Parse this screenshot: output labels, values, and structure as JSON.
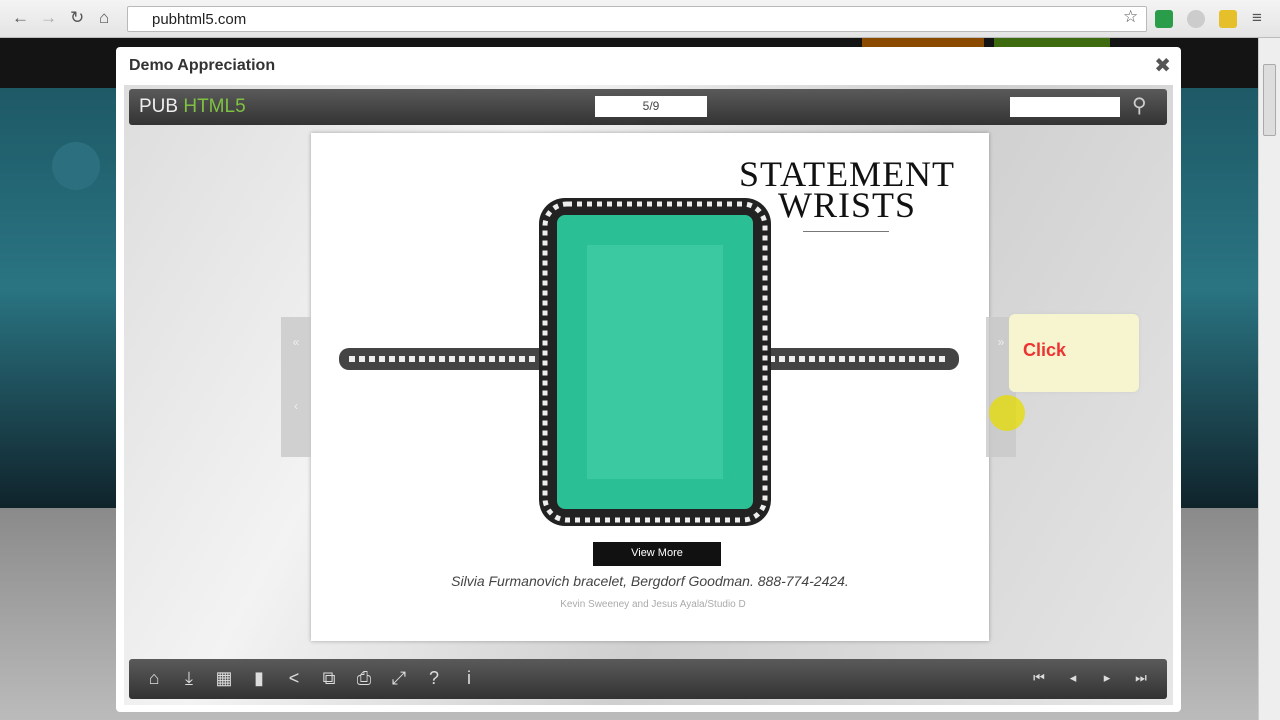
{
  "browser": {
    "url": "pubhtml5.com"
  },
  "modal": {
    "title": "Demo Appreciation",
    "close": "✖"
  },
  "viewer": {
    "logo_pub": "PUB",
    "logo_html5": "HTML5",
    "page_indicator": "5/9",
    "search_value": "",
    "page": {
      "heading_line1": "STATEMENT",
      "heading_line2": "WRISTS",
      "button": "View More",
      "caption": "Silvia Furmanovich bracelet, Bergdorf Goodman. 888-774-2424.",
      "credit": "Kevin Sweeney and Jesus Ayala/Studio D"
    },
    "tooltip": "Click",
    "accent": "#7fc242",
    "toolbar_icons": [
      "home-icon",
      "download-icon",
      "thumbnails-icon",
      "bookmark-icon",
      "share-icon",
      "auto-flip-icon",
      "print-icon",
      "fullscreen-icon",
      "help-icon",
      "info-icon"
    ],
    "toolbar_glyphs": [
      "⌂",
      "⤓",
      "▦",
      "▮",
      "<",
      "⧉",
      "⎙",
      "⤢",
      "?",
      "i"
    ],
    "nav_glyphs": [
      "⏮",
      "◂",
      "▸",
      "⏭"
    ]
  }
}
